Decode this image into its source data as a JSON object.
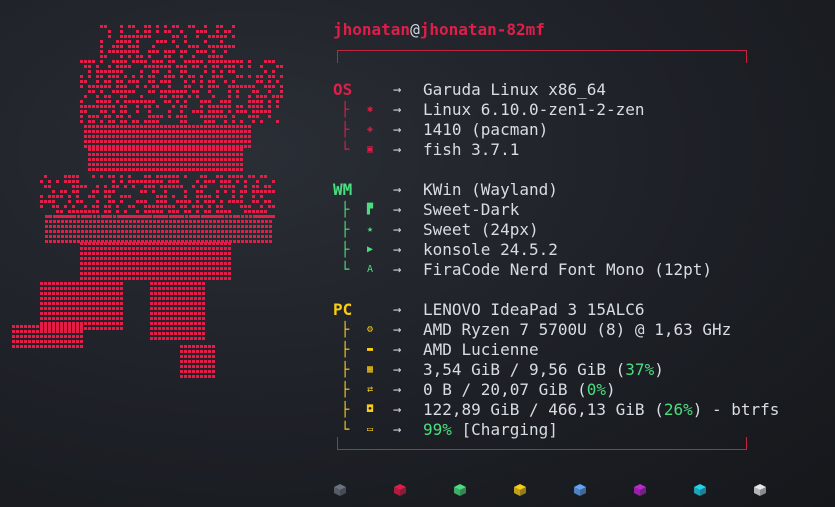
{
  "header": {
    "user": "jhonatan",
    "at": "@",
    "host": "jhonatan-82mf"
  },
  "os_section": {
    "key": "OS",
    "color": "#e11d48",
    "rows": [
      {
        "icon": "os-icon",
        "value": "Garuda Linux x86_64"
      },
      {
        "icon": "kernel-icon",
        "value": "Linux 6.10.0-zen1-2-zen"
      },
      {
        "icon": "packages-icon",
        "value": "1410 (pacman)"
      },
      {
        "icon": "shell-icon",
        "value": "fish 3.7.1"
      }
    ]
  },
  "wm_section": {
    "key": "WM",
    "color": "#4ade80",
    "rows": [
      {
        "icon": "wm-icon",
        "value": "KWin (Wayland)"
      },
      {
        "icon": "theme-brush-icon",
        "value": "Sweet-Dark"
      },
      {
        "icon": "star-icon",
        "value": "Sweet (24px)"
      },
      {
        "icon": "terminal-icon",
        "value": "konsole 24.5.2"
      },
      {
        "icon": "font-icon",
        "value": "FiraCode Nerd Font Mono (12pt)"
      }
    ]
  },
  "pc_section": {
    "key": "PC",
    "color": "#facc15",
    "rows": [
      {
        "icon": "host-icon",
        "value": "LENOVO IdeaPad 3 15ALC6"
      },
      {
        "icon": "cpu-icon",
        "value": "AMD Ryzen 7 5700U (8) @ 1,63 GHz"
      },
      {
        "icon": "gpu-icon",
        "value": "AMD Lucienne"
      },
      {
        "icon": "memory-icon",
        "value_prefix": "3,54 GiB / 9,56 GiB (",
        "percent": "37%",
        "value_suffix": ")"
      },
      {
        "icon": "swap-icon",
        "value_prefix": "0 B / 20,07 GiB (",
        "percent": "0%",
        "value_suffix": ")"
      },
      {
        "icon": "disk-icon",
        "value_prefix": "122,89 GiB / 466,13 GiB (",
        "percent": "26%",
        "value_suffix": ") - btrfs"
      },
      {
        "icon": "battery-icon",
        "percent": "99%",
        "value_suffix": " [Charging]"
      }
    ]
  },
  "arrow_glyph": "→",
  "palette": [
    "#6b7280",
    "#e11d48",
    "#4ade80",
    "#facc15",
    "#60a5fa",
    "#c026d3",
    "#22d3ee",
    "#e5e7eb"
  ]
}
